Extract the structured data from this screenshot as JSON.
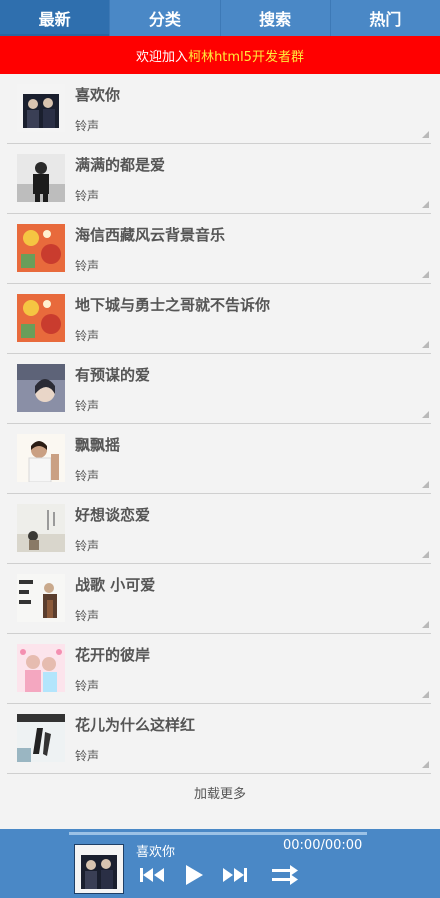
{
  "tabs": [
    {
      "label": "最新"
    },
    {
      "label": "分类"
    },
    {
      "label": "搜索"
    },
    {
      "label": "热门"
    }
  ],
  "banner": {
    "prefix": "欢迎加入",
    "link_text": "柯林html5开发者群"
  },
  "songs": [
    {
      "title": "喜欢你",
      "subtitle": "铃声"
    },
    {
      "title": "满满的都是爱",
      "subtitle": "铃声"
    },
    {
      "title": "海信西藏风云背景音乐",
      "subtitle": "铃声"
    },
    {
      "title": "地下城与勇士之哥就不告诉你",
      "subtitle": "铃声"
    },
    {
      "title": "有预谋的爱",
      "subtitle": "铃声"
    },
    {
      "title": "飘飘摇",
      "subtitle": "铃声"
    },
    {
      "title": "好想谈恋爱",
      "subtitle": "铃声"
    },
    {
      "title": "战歌 小可爱",
      "subtitle": "铃声"
    },
    {
      "title": "花开的彼岸",
      "subtitle": "铃声"
    },
    {
      "title": "花儿为什么这样红",
      "subtitle": "铃声"
    }
  ],
  "load_more": "加载更多",
  "player": {
    "title": "喜欢你",
    "time": "00:00/00:00",
    "progress": 0
  },
  "colors": {
    "header": "#4a88c6",
    "active_tab": "#2f6fae",
    "banner": "#ff0000",
    "banner_link": "#ffeb3b"
  },
  "icons": [
    "previous-icon",
    "play-icon",
    "next-icon",
    "repeat-icon",
    "list-corner-icon"
  ]
}
